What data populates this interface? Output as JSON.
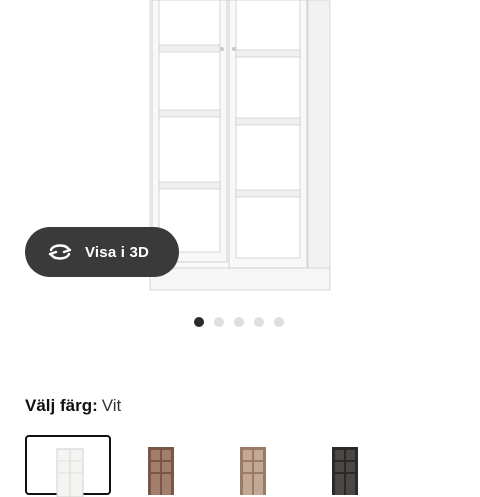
{
  "gallery": {
    "view3d_label": "Visa i 3D",
    "view3d_icon": "rotate-3d-icon",
    "dots_count": 5,
    "active_dot": 0
  },
  "color_selector": {
    "label": "Välj färg:",
    "selected_value": "Vit",
    "options": [
      {
        "name": "white",
        "color": "#f4f4f2",
        "selected": true
      },
      {
        "name": "brown",
        "color": "#7a5645",
        "selected": false
      },
      {
        "name": "oak-brown",
        "color": "#9b7a66",
        "selected": false
      },
      {
        "name": "black",
        "color": "#2c2a28",
        "selected": false
      }
    ]
  },
  "colors": {
    "button_bg": "#3a3a3a",
    "dot_active": "#2b2b2b",
    "dot_inactive": "#dfdfdf"
  }
}
